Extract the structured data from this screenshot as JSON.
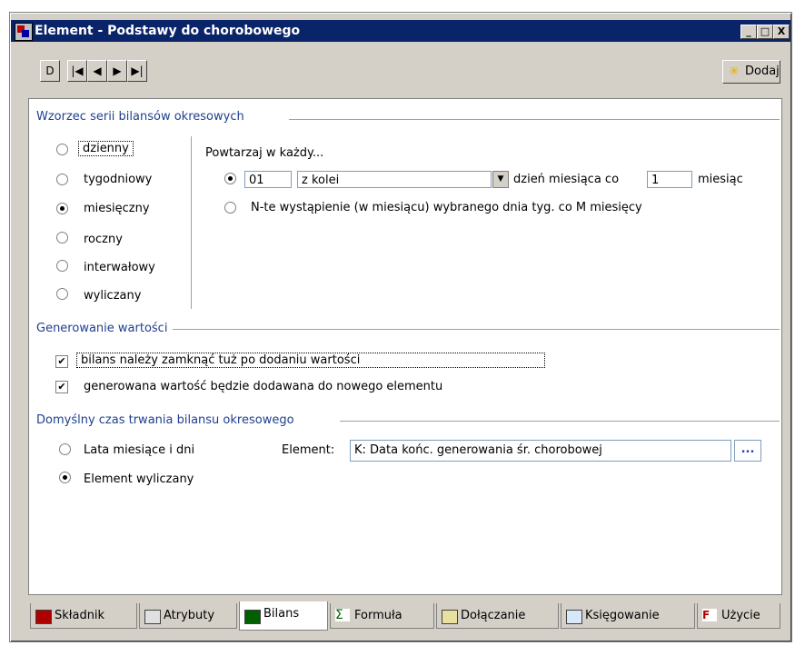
{
  "window": {
    "title": "Element - Podstawy do chorobowego",
    "min_label": "_",
    "max_label": "□",
    "close_label": "X"
  },
  "toolbar": {
    "nav": [
      {
        "name": "nav-new-button",
        "label": "D"
      },
      {
        "name": "nav-first-button",
        "label": "|◀"
      },
      {
        "name": "nav-prev-button",
        "label": "◀"
      },
      {
        "name": "nav-next-button",
        "label": "▶"
      },
      {
        "name": "nav-last-button",
        "label": "▶|"
      }
    ],
    "add_label": "Dodaj"
  },
  "series_pattern": {
    "heading": "Wzorzec serii bilansów okresowych",
    "options": [
      {
        "label": "dzienny",
        "selected": false
      },
      {
        "label": "tygodniowy",
        "selected": false
      },
      {
        "label": "miesięczny",
        "selected": true
      },
      {
        "label": "roczny",
        "selected": false
      },
      {
        "label": "interwałowy",
        "selected": false
      },
      {
        "label": "wyliczany",
        "selected": false
      }
    ],
    "repeat_label": "Powtarzaj w każdy...",
    "row1": {
      "day_value": "01",
      "mode_value": "z kolei",
      "text_mid": "dzień miesiąca co",
      "every_value": "1",
      "text_end": "miesiąc"
    },
    "row2_label": "N-te wystąpienie (w miesiącu) wybranego dnia tyg. co M miesięcy"
  },
  "generation": {
    "heading": "Generowanie wartości",
    "check1_label": "bilans należy zamknąć tuż po dodaniu wartości",
    "check2_label": "generowana wartość będzie dodawana do nowego elementu"
  },
  "duration": {
    "heading": "Domyślny czas trwania bilansu okresowego",
    "opt1_label": "Lata miesiące i dni",
    "opt2_label": "Element wyliczany",
    "element_label": "Element:",
    "element_value": "K: Data końc. generowania śr. chorobowej",
    "browse_label": "..."
  },
  "tabs": [
    {
      "label": "Składnik",
      "active": false
    },
    {
      "label": "Atrybuty",
      "active": false
    },
    {
      "label": "Bilans",
      "active": true
    },
    {
      "label": "Formuła",
      "active": false
    },
    {
      "label": "Dołączanie",
      "active": false
    },
    {
      "label": "Księgowanie",
      "active": false
    },
    {
      "label": "Użycie",
      "active": false
    }
  ]
}
